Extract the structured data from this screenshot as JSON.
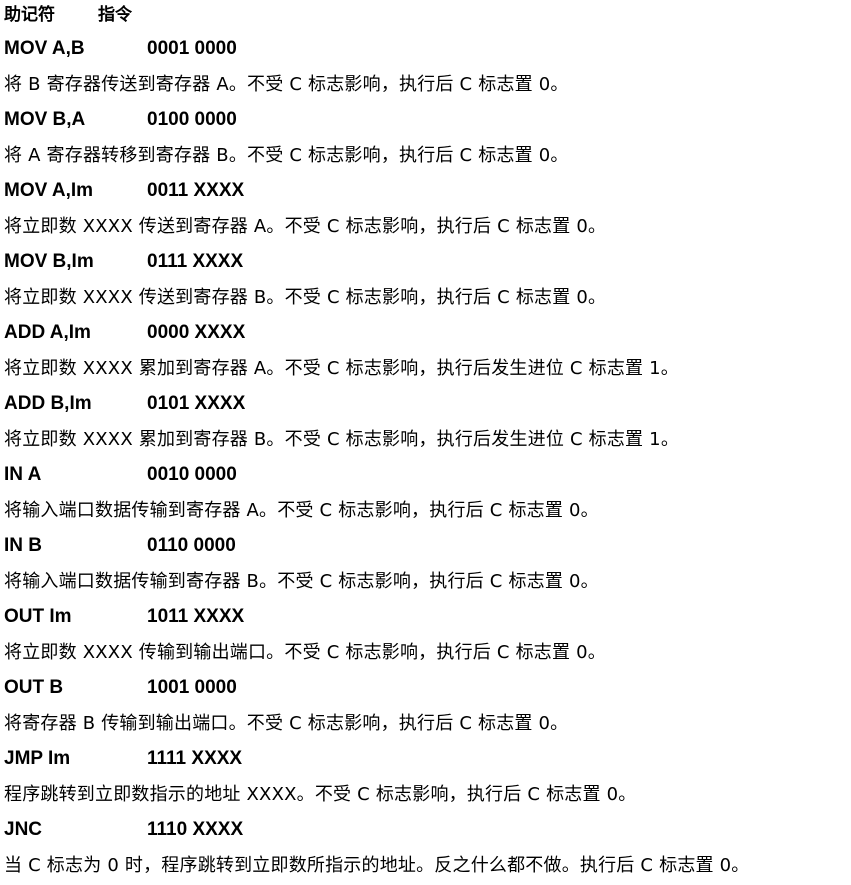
{
  "header": {
    "mnemonic_label": "助记符",
    "instruction_label": "指令"
  },
  "instructions": [
    {
      "mnemonic": "MOV A,B",
      "opcode": "0001 0000",
      "description": "将  B  寄存器传送到寄存器 A。不受 C 标志影响，执行后 C 标志置 0。"
    },
    {
      "mnemonic": "MOV B,A",
      "opcode": "0100 0000",
      "description": "将  A  寄存器转移到寄存器 B。不受 C 标志影响，执行后 C 标志置 0。"
    },
    {
      "mnemonic": "MOV A,Im",
      "opcode": "0011 XXXX",
      "description": "将立即数 XXXX 传送到寄存器 A。不受 C 标志影响，执行后 C 标志置 0。"
    },
    {
      "mnemonic": "MOV B,Im",
      "opcode": "0111 XXXX",
      "description": "将立即数 XXXX 传送到寄存器 B。不受 C 标志影响，执行后 C 标志置 0。"
    },
    {
      "mnemonic": "ADD A,Im",
      "opcode": "0000 XXXX",
      "description": "将立即数 XXXX 累加到寄存器 A。不受 C 标志影响，执行后发生进位 C 标志置 1。"
    },
    {
      "mnemonic": "ADD B,Im",
      "opcode": "0101 XXXX",
      "description": "将立即数 XXXX 累加到寄存器 B。不受 C 标志影响，执行后发生进位 C 标志置 1。"
    },
    {
      "mnemonic": "IN A",
      "opcode": "0010 0000",
      "description": "将输入端口数据传输到寄存器 A。不受 C 标志影响，执行后 C 标志置 0。"
    },
    {
      "mnemonic": "IN B",
      "opcode": "0110 0000",
      "description": "将输入端口数据传输到寄存器 B。不受 C 标志影响，执行后 C 标志置 0。"
    },
    {
      "mnemonic": "OUT Im",
      "opcode": "1011 XXXX",
      "description": "将立即数 XXXX 传输到输出端口。不受 C 标志影响，执行后 C 标志置 0。"
    },
    {
      "mnemonic": "OUT B",
      "opcode": "1001 0000",
      "description": "将寄存器 B 传输到输出端口。不受 C 标志影响，执行后 C 标志置 0。"
    },
    {
      "mnemonic": "JMP Im",
      "opcode": "1111 XXXX",
      "description": "程序跳转到立即数指示的地址 XXXX。不受 C 标志影响，执行后 C 标志置 0。"
    },
    {
      "mnemonic": "JNC",
      "opcode": "1110 XXXX",
      "description": "当 C 标志为 0 时，程序跳转到立即数所指示的地址。反之什么都不做。执行后 C 标志置 0。"
    }
  ]
}
